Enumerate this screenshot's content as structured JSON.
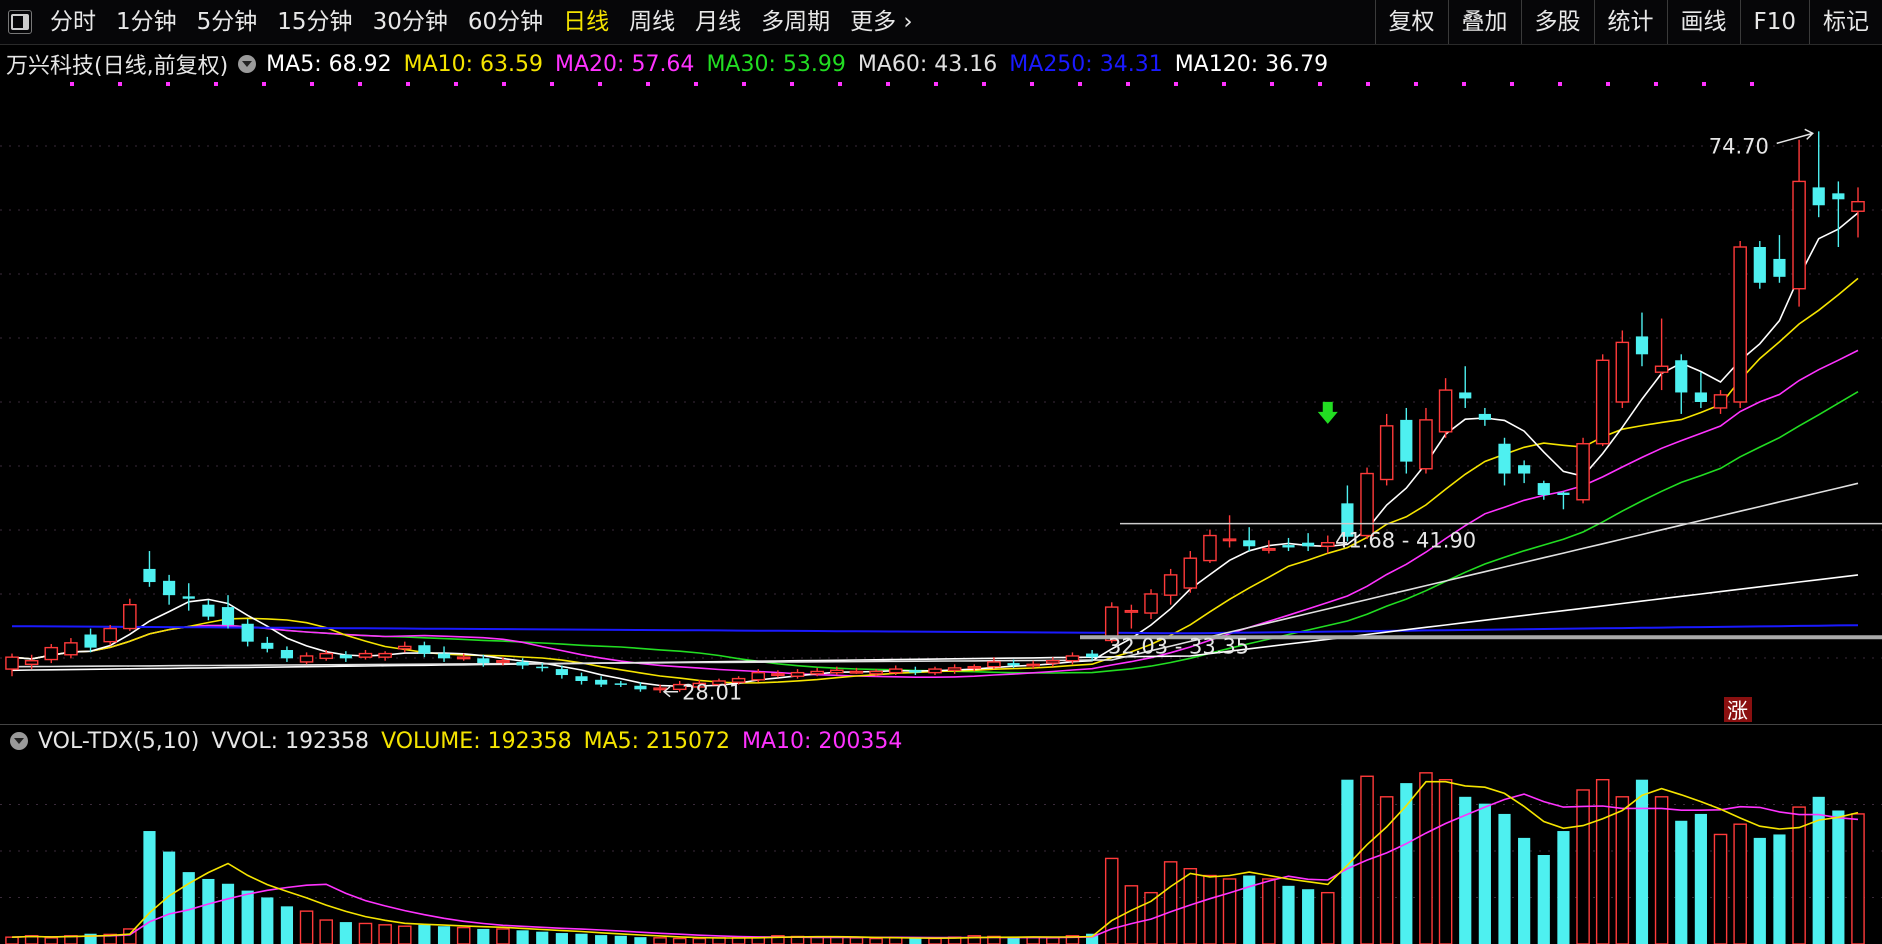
{
  "toolbar": {
    "periods": [
      "分时",
      "1分钟",
      "5分钟",
      "15分钟",
      "30分钟",
      "60分钟",
      "日线",
      "周线",
      "月线",
      "多周期",
      "更多"
    ],
    "active_period": "日线",
    "more_chevron": "›",
    "tools": [
      "复权",
      "叠加",
      "多股",
      "统计",
      "画线",
      "F10",
      "标记"
    ]
  },
  "main_legend": {
    "title": "万兴科技(日线,前复权)",
    "mas": [
      {
        "label": "MA5: 68.92",
        "color": "#ffffff"
      },
      {
        "label": "MA10: 63.59",
        "color": "#f5e400"
      },
      {
        "label": "MA20: 57.64",
        "color": "#ff33ff"
      },
      {
        "label": "MA30: 53.99",
        "color": "#22dd22"
      },
      {
        "label": "MA60: 43.16",
        "color": "#e0e0e0"
      },
      {
        "label": "MA250: 34.31",
        "color": "#1a1aff"
      },
      {
        "label": "MA120: 36.79",
        "color": "#ffffff"
      }
    ]
  },
  "annotations": {
    "high": "74.70",
    "low": "28.01",
    "range1": "41.68 - 41.90",
    "range2": "32.03 - 33.35",
    "zhang": "涨"
  },
  "vol_legend": {
    "label": "VOL-TDX(5,10)",
    "vvol": "VVOL: 192358",
    "volume": "VOLUME: 192358",
    "ma5": "MA5: 215072",
    "ma10": "MA10: 200354",
    "colors": {
      "label": "#e6e6e6",
      "volume": "#f5e400",
      "ma5": "#f5e400",
      "ma10": "#ff33ff"
    }
  },
  "colors": {
    "up": "#ff3a3a",
    "down": "#4ef0f0",
    "ma5": "#ffffff",
    "ma10": "#f5e400",
    "ma20": "#ff33ff",
    "ma30": "#22dd22",
    "ma60": "#e0e0e0",
    "ma250": "#1a1aff",
    "ma120": "#ffffff"
  },
  "chart_data": {
    "type": "candlestick",
    "price_range": [
      26,
      78
    ],
    "candles": [
      [
        29.6,
        30.6,
        29.0,
        30.9
      ],
      [
        30.0,
        30.3,
        29.6,
        30.8
      ],
      [
        30.4,
        31.4,
        30.1,
        31.7
      ],
      [
        30.8,
        31.8,
        30.5,
        32.2
      ],
      [
        32.5,
        31.4,
        31.0,
        33.0
      ],
      [
        31.9,
        33.0,
        31.6,
        33.3
      ],
      [
        33.0,
        35.0,
        32.8,
        35.5
      ],
      [
        38.0,
        36.9,
        36.5,
        39.5
      ],
      [
        37.0,
        35.8,
        35.0,
        37.5
      ],
      [
        35.7,
        35.5,
        34.5,
        36.8
      ],
      [
        35.0,
        34.0,
        33.7,
        35.4
      ],
      [
        34.8,
        33.3,
        33.0,
        35.8
      ],
      [
        33.4,
        31.9,
        31.5,
        33.8
      ],
      [
        31.8,
        31.3,
        31.0,
        32.3
      ],
      [
        31.2,
        30.5,
        30.2,
        31.5
      ],
      [
        30.2,
        30.7,
        30.0,
        31.0
      ],
      [
        30.5,
        30.9,
        30.3,
        31.2
      ],
      [
        30.8,
        30.5,
        30.2,
        31.1
      ],
      [
        30.6,
        30.9,
        30.4,
        31.2
      ],
      [
        30.6,
        30.9,
        30.3,
        31.1
      ],
      [
        31.3,
        31.5,
        31.0,
        31.9
      ],
      [
        31.6,
        30.9,
        30.6,
        31.9
      ],
      [
        30.9,
        30.5,
        30.2,
        31.5
      ],
      [
        30.6,
        30.6,
        30.3,
        30.9
      ],
      [
        30.5,
        30.1,
        29.8,
        30.8
      ],
      [
        30.2,
        30.3,
        29.9,
        30.6
      ],
      [
        30.2,
        29.9,
        29.6,
        30.5
      ],
      [
        29.8,
        29.7,
        29.4,
        30.1
      ],
      [
        29.6,
        29.1,
        28.8,
        29.9
      ],
      [
        29.0,
        28.6,
        28.3,
        29.3
      ],
      [
        28.7,
        28.3,
        28.1,
        29.0
      ],
      [
        28.4,
        28.3,
        28.1,
        28.6
      ],
      [
        28.2,
        27.9,
        27.7,
        28.5
      ],
      [
        27.9,
        28.0,
        27.6,
        28.3
      ],
      [
        27.9,
        28.3,
        27.7,
        28.6
      ],
      [
        28.1,
        28.4,
        27.9,
        28.7
      ],
      [
        28.3,
        28.6,
        28.1,
        28.8
      ],
      [
        28.5,
        28.8,
        28.3,
        29.0
      ],
      [
        28.7,
        29.3,
        28.5,
        29.6
      ],
      [
        29.1,
        29.2,
        28.9,
        29.5
      ],
      [
        29.0,
        29.3,
        28.8,
        29.6
      ],
      [
        29.2,
        29.4,
        29.0,
        29.7
      ],
      [
        29.3,
        29.5,
        29.1,
        29.8
      ],
      [
        29.4,
        29.4,
        29.2,
        29.7
      ],
      [
        29.2,
        29.4,
        29.0,
        29.6
      ],
      [
        29.3,
        29.6,
        29.1,
        29.9
      ],
      [
        29.5,
        29.3,
        29.1,
        29.8
      ],
      [
        29.3,
        29.6,
        29.1,
        29.8
      ],
      [
        29.5,
        29.7,
        29.2,
        30.0
      ],
      [
        29.7,
        29.8,
        29.4,
        30.0
      ],
      [
        29.8,
        30.2,
        29.6,
        30.6
      ],
      [
        30.1,
        29.9,
        29.7,
        30.4
      ],
      [
        29.9,
        30.0,
        29.6,
        30.3
      ],
      [
        30.1,
        30.3,
        29.8,
        30.6
      ],
      [
        30.3,
        30.7,
        30.0,
        31.0
      ],
      [
        30.9,
        30.6,
        30.3,
        31.2
      ],
      [
        32.0,
        34.8,
        31.8,
        35.2
      ],
      [
        34.5,
        34.5,
        33.0,
        35.0
      ],
      [
        34.3,
        35.9,
        33.8,
        36.3
      ],
      [
        35.8,
        37.5,
        35.0,
        38.0
      ],
      [
        36.4,
        38.9,
        36.0,
        39.5
      ],
      [
        38.7,
        40.8,
        38.5,
        41.3
      ],
      [
        40.4,
        40.5,
        39.8,
        42.5
      ],
      [
        40.4,
        39.9,
        39.5,
        41.5
      ],
      [
        39.6,
        39.7,
        39.3,
        40.4
      ],
      [
        40.0,
        39.8,
        39.5,
        40.6
      ],
      [
        40.2,
        39.9,
        39.5,
        41.0
      ],
      [
        39.9,
        40.2,
        39.3,
        40.8
      ],
      [
        43.5,
        40.7,
        40.3,
        45.0
      ],
      [
        40.8,
        46.0,
        40.5,
        46.5
      ],
      [
        45.5,
        50.0,
        45.0,
        51.0
      ],
      [
        50.5,
        47.0,
        46.0,
        51.5
      ],
      [
        46.4,
        50.5,
        46.0,
        51.5
      ],
      [
        49.5,
        53.0,
        49.0,
        54.0
      ],
      [
        52.8,
        52.3,
        51.5,
        55.0
      ],
      [
        51.0,
        50.5,
        50.0,
        51.5
      ],
      [
        48.5,
        46.0,
        45.0,
        49.0
      ],
      [
        46.7,
        46.0,
        45.2,
        47.1
      ],
      [
        45.2,
        44.2,
        43.8,
        45.4
      ],
      [
        44.4,
        44.2,
        43.0,
        44.5
      ],
      [
        43.8,
        48.5,
        43.5,
        49.0
      ],
      [
        48.5,
        55.5,
        48.3,
        56.0
      ],
      [
        52.0,
        57.0,
        51.5,
        58.0
      ],
      [
        57.5,
        56.0,
        55.0,
        59.5
      ],
      [
        54.5,
        55.0,
        53.0,
        59.0
      ],
      [
        55.5,
        52.8,
        51.0,
        56.0
      ],
      [
        52.8,
        52.0,
        51.5,
        54.5
      ],
      [
        51.5,
        52.6,
        51.0,
        53.0
      ],
      [
        52.0,
        65.0,
        51.5,
        65.5
      ],
      [
        65.0,
        62.0,
        61.5,
        65.5
      ],
      [
        64.0,
        62.5,
        62.0,
        66.0
      ],
      [
        61.5,
        70.5,
        60.0,
        74.0
      ],
      [
        70.0,
        68.5,
        67.5,
        74.7
      ],
      [
        69.5,
        69.0,
        65.0,
        70.5
      ],
      [
        68.0,
        68.8,
        65.8,
        70.0
      ]
    ],
    "volume_range": [
      0,
      260000
    ],
    "volumes": [
      10000,
      12000,
      9000,
      12000,
      15000,
      14000,
      22000,
      165000,
      135000,
      105000,
      95000,
      88000,
      78000,
      68000,
      55000,
      48000,
      35000,
      32000,
      30000,
      28000,
      26000,
      28000,
      26000,
      24000,
      22000,
      22000,
      20000,
      18000,
      16000,
      15000,
      13000,
      12000,
      10000,
      9000,
      8000,
      8000,
      9000,
      10000,
      10000,
      12000,
      11000,
      10000,
      10000,
      9000,
      8000,
      9000,
      8000,
      8000,
      10000,
      12000,
      11000,
      9000,
      10000,
      9000,
      12000,
      15000,
      125000,
      85000,
      75000,
      120000,
      110000,
      100000,
      95000,
      100000,
      95000,
      85000,
      80000,
      75000,
      240000,
      245000,
      215000,
      235000,
      250000,
      240000,
      215000,
      205000,
      190000,
      155000,
      130000,
      165000,
      225000,
      240000,
      215000,
      240000,
      215000,
      180000,
      190000,
      160000,
      175000,
      155000,
      160000,
      200000,
      215000,
      195000,
      190000
    ]
  }
}
